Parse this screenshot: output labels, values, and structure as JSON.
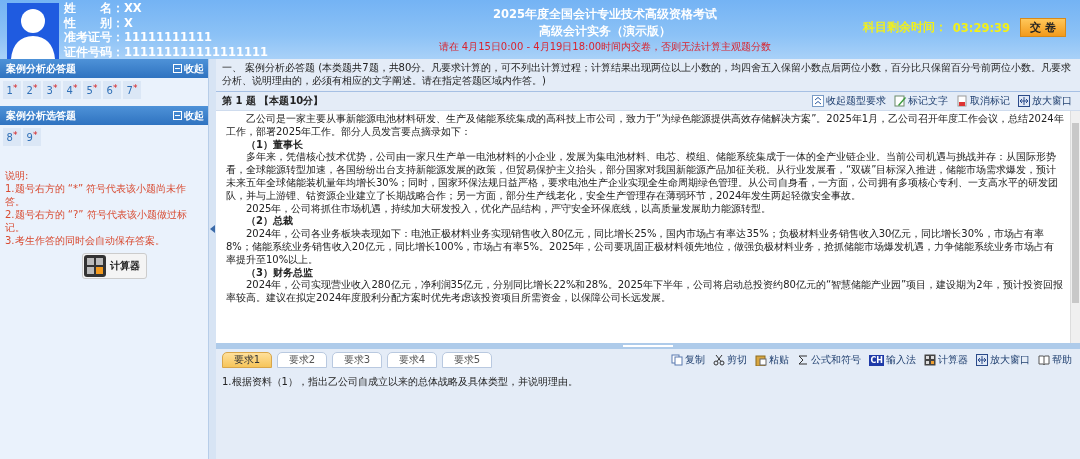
{
  "candidate": {
    "fields": [
      {
        "label": "姓　　名：",
        "value": "XX"
      },
      {
        "label": "性　　别：",
        "value": "X"
      },
      {
        "label": "准考证号：",
        "value": "11111111111"
      },
      {
        "label": "证件号码：",
        "value": "111111111111111111"
      }
    ]
  },
  "exam": {
    "title": "2025年度全国会计专业技术高级资格考试",
    "subtitle": "高级会计实务（演示版）",
    "notice": "请在 4月15日0:00 - 4月19日18:00时间内交卷，否则无法计算主观题分数"
  },
  "timer": {
    "label": "科目剩余时间：",
    "value": "03:29:39"
  },
  "submit_button": "交 卷",
  "sidebar": {
    "sections": [
      {
        "title": "案例分析必答题",
        "toggle": "收起",
        "items": [
          {
            "number": "1",
            "mark": "*"
          },
          {
            "number": "2",
            "mark": "*"
          },
          {
            "number": "3",
            "mark": "*"
          },
          {
            "number": "4",
            "mark": "*"
          },
          {
            "number": "5",
            "mark": "*"
          },
          {
            "number": "6",
            "mark": "*"
          },
          {
            "number": "7",
            "mark": "*"
          }
        ]
      },
      {
        "title": "案例分析选答题",
        "toggle": "收起",
        "items": [
          {
            "number": "8",
            "mark": "*"
          },
          {
            "number": "9",
            "mark": "*"
          }
        ]
      }
    ],
    "notes": [
      "说明:",
      "1.题号右方的 “*” 符号代表该小题尚未作答。",
      "2.题号右方的 “?” 符号代表该小题做过标记。",
      "3.考生作答的同时会自动保存答案。"
    ],
    "calculator_button": "计算器"
  },
  "instructions": "一、 案例分析必答题 (本类题共7题，共80分。凡要求计算的，可不列出计算过程；计算结果出现两位以上小数的，均四舍五入保留小数点后两位小数，百分比只保留百分号前两位小数。凡要求分析、说明理由的，必须有相应的文字阐述。请在指定答题区域内作答。)",
  "question": {
    "header": "第 1 题 【本题10分】",
    "tools": [
      {
        "kind": "collapse",
        "label": "收起题型要求"
      },
      {
        "kind": "mark",
        "label": "标记文字"
      },
      {
        "kind": "unmark",
        "label": "取消标记"
      },
      {
        "kind": "enlarge",
        "label": "放大窗口"
      }
    ],
    "passage": [
      {
        "kind": "para",
        "text": "乙公司是一家主要从事新能源电池材料研发、生产及储能系统集成的高科技上市公司，致力于“为绿色能源提供高效存储解决方案”。2025年1月，乙公司召开年度工作会议，总结2024年工作，部署2025年工作。部分人员发言要点摘录如下："
      },
      {
        "kind": "heading",
        "text": "（1）董事长"
      },
      {
        "kind": "para",
        "text": "多年来，凭借核心技术优势，公司由一家只生产单一电池材料的小企业，发展为集电池材料、电芯、模组、储能系统集成于一体的全产业链企业。当前公司机遇与挑战并存：从国际形势看，全球能源转型加速，各国纷纷出台支持新能源发展的政策，但贸易保护主义抬头，部分国家对我国新能源产品加征关税。从行业发展看，“双碳”目标深入推进，储能市场需求爆发，预计未来五年全球储能装机量年均增长30%；同时，国家环保法规日益严格，要求电池生产企业实现全生命周期绿色管理。从公司自身看，一方面，公司拥有多项核心专利、一支高水平的研发团队，并与上游锂、钴资源企业建立了长期战略合作；另一方面，部分生产线老化，安全生产管理存在薄弱环节，2024年发生两起轻微安全事故。"
      },
      {
        "kind": "para",
        "text": "2025年，公司将抓住市场机遇，持续加大研发投入，优化产品结构，严守安全环保底线，以高质量发展助力能源转型。"
      },
      {
        "kind": "heading",
        "text": "（2）总裁"
      },
      {
        "kind": "para",
        "text": "2024年，公司各业务板块表现如下：电池正极材料业务实现销售收入80亿元，同比增长25%，国内市场占有率达35%；负极材料业务销售收入30亿元，同比增长30%，市场占有率8%；储能系统业务销售收入20亿元，同比增长100%，市场占有率5%。2025年，公司要巩固正极材料领先地位，做强负极材料业务，抢抓储能市场爆发机遇，力争储能系统业务市场占有率提升至10%以上。"
      },
      {
        "kind": "heading",
        "text": "（3）财务总监"
      },
      {
        "kind": "para",
        "text": "2024年，公司实现营业收入280亿元，净利润35亿元，分别同比增长22%和28%。2025年下半年，公司将启动总投资约80亿元的“智慧储能产业园”项目，建设期为2年，预计投资回报率较高。建议在拟定2024年度股利分配方案时优先考虑该投资项目所需资金，以保障公司长远发展。"
      }
    ]
  },
  "requirements": {
    "tabs": [
      {
        "label": "要求1",
        "selected": true
      },
      {
        "label": "要求2",
        "selected": false
      },
      {
        "label": "要求3",
        "selected": false
      },
      {
        "label": "要求4",
        "selected": false
      },
      {
        "label": "要求5",
        "selected": false
      }
    ],
    "tools": [
      {
        "kind": "copy",
        "label": "复制"
      },
      {
        "kind": "cut",
        "label": "剪切"
      },
      {
        "kind": "paste",
        "label": "粘贴"
      },
      {
        "kind": "sigma",
        "label": "公式和符号"
      },
      {
        "kind": "ime",
        "label": "输入法",
        "badge": "CH"
      },
      {
        "kind": "calc",
        "label": "计算器"
      },
      {
        "kind": "enlarge",
        "label": "放大窗口"
      },
      {
        "kind": "help",
        "label": "帮助"
      }
    ],
    "text": "1.根据资料（1），指出乙公司自成立以来的总体战略及具体类型，并说明理由。"
  }
}
